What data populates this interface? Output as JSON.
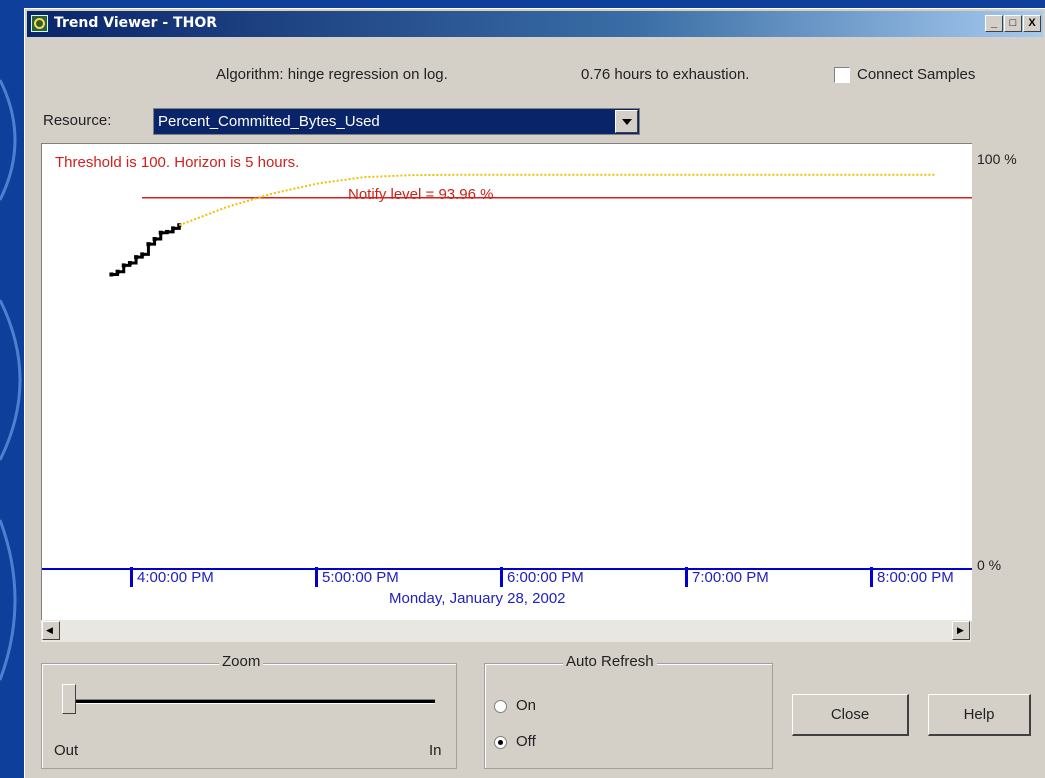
{
  "window": {
    "title": "Trend Viewer - THOR"
  },
  "title_buttons": {
    "minimize": "_",
    "maximize": "□",
    "close": "X"
  },
  "header": {
    "algorithm": "Algorithm: hinge regression on log.",
    "exhaustion": "0.76 hours to exhaustion.",
    "connect_samples_label": "Connect Samples",
    "connect_samples_checked": false
  },
  "resource": {
    "label": "Resource:",
    "selected": "Percent_Committed_Bytes_Used"
  },
  "chart_data": {
    "type": "line",
    "annotations": [
      "Threshold is 100. Horizon is 5 hours.",
      "Notify level = 93.96 %"
    ],
    "y_tick_labels": [
      "100 %",
      "0 %"
    ],
    "ylim": [
      0,
      100
    ],
    "x_tick_labels": [
      "4:00:00 PM",
      "5:00:00 PM",
      "6:00:00 PM",
      "7:00:00 PM",
      "8:00:00 PM"
    ],
    "xlabel": "Monday, January 28, 2002",
    "threshold": 100,
    "notify_level": 93.96,
    "series": [
      {
        "kind": "samples",
        "color": "#000000",
        "x": [
          "3:53:00 PM",
          "3:55:00 PM",
          "3:57:00 PM",
          "3:59:00 PM",
          "4:01:00 PM",
          "4:03:00 PM",
          "4:05:00 PM",
          "4:07:00 PM",
          "4:09:00 PM",
          "4:11:00 PM",
          "4:13:00 PM",
          "4:15:00 PM"
        ],
        "y": [
          74.5,
          75.2,
          76.8,
          77.4,
          78.9,
          79.6,
          82.2,
          83.5,
          85.1,
          85.3,
          86.2,
          87.0
        ]
      },
      {
        "kind": "projection",
        "color": "#f0c000",
        "x": [
          "4:15:00 PM",
          "4:30:00 PM",
          "4:45:00 PM",
          "5:00:00 PM",
          "5:15:00 PM",
          "5:30:00 PM",
          "5:45:00 PM",
          "6:00:00 PM",
          "6:30:00 PM",
          "7:00:00 PM",
          "7:30:00 PM",
          "8:00:00 PM",
          "8:20:00 PM"
        ],
        "y": [
          87.0,
          91.5,
          95.0,
          97.6,
          99.2,
          99.7,
          99.8,
          99.8,
          99.8,
          99.8,
          99.8,
          99.8,
          99.8
        ]
      }
    ],
    "line_colors": {
      "threshold": "#d0201a",
      "axis": "#0000d0",
      "text_red": "#d0201a",
      "text_blue": "#2020c0"
    }
  },
  "zoom": {
    "legend": "Zoom",
    "out_label": "Out",
    "in_label": "In",
    "level": 0
  },
  "auto_refresh": {
    "legend": "Auto Refresh",
    "on_label": "On",
    "off_label": "Off",
    "selected": "Off"
  },
  "buttons": {
    "close": "Close",
    "help": "Help"
  },
  "scroll_arrows": {
    "left": "◀",
    "right": "▶"
  }
}
